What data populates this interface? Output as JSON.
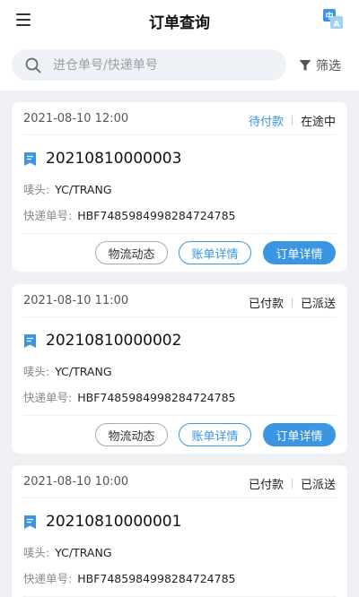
{
  "header": {
    "title": "订单查询"
  },
  "search": {
    "placeholder": "进仓单号/快递单号",
    "value": "",
    "filter_label": "筛选"
  },
  "labels": {
    "mark_label": "唛头:",
    "tracking_label": "快递单号:",
    "logistics_button": "物流动态",
    "bill_button": "账单详情",
    "order_button": "订单详情"
  },
  "orders": [
    {
      "datetime": "2021-08-10 12:00",
      "payment_status": "待付款",
      "shipping_status": "在途中",
      "order_no": "20210810000003",
      "mark": "YC/TRANG",
      "tracking_no": "HBF7485984998284724785"
    },
    {
      "datetime": "2021-08-10 11:00",
      "payment_status": "已付款",
      "shipping_status": "已派送",
      "order_no": "20210810000002",
      "mark": "YC/TRANG",
      "tracking_no": "HBF7485984998284724785"
    },
    {
      "datetime": "2021-08-10 10:00",
      "payment_status": "已付款",
      "shipping_status": "已派送",
      "order_no": "20210810000001",
      "mark": "YC/TRANG",
      "tracking_no": "HBF7485984998284724785"
    }
  ],
  "colors": {
    "accent": "#3a95e3",
    "background": "#eef0f3"
  }
}
